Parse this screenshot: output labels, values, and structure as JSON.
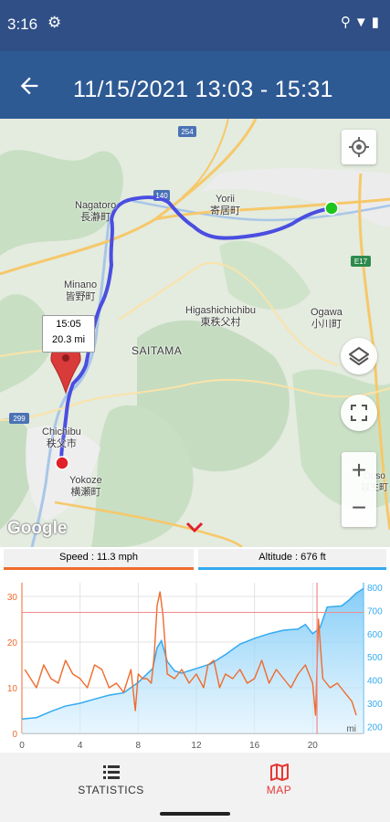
{
  "status": {
    "time": "3:16",
    "icons": [
      "gear-icon",
      "location-icon",
      "wifi-icon",
      "battery-icon"
    ]
  },
  "app_bar": {
    "title": "11/15/2021 13:03 - 15:31",
    "back_icon": "arrow-back-icon"
  },
  "map": {
    "labels": {
      "nagatoro": "Nagatoro\n長瀞町",
      "yorii": "Yorii\n寄居町",
      "minano": "Minano\n皆野町",
      "higashi": "Higashichichibu\n東秩父村",
      "ogawa": "Ogawa\n小川町",
      "saitama": "SAITAMA",
      "chichibu": "Chichibu\n秩父市",
      "yokoze": "Yokoze\n横瀬町",
      "ooso": "Ooso\n越生町",
      "road254": "254",
      "road140": "140",
      "roadE17": "E17",
      "road299": "299"
    },
    "tooltip": {
      "time": "15:05",
      "distance": "20.3 mi"
    },
    "google_logo": "Google",
    "buttons": {
      "my_location": "my-location-icon",
      "layers": "layers-icon",
      "fullscreen": "fullscreen-icon",
      "zoom_in": "+",
      "zoom_out": "−"
    },
    "colors": {
      "route": "#4a4ee0",
      "start": "#1ec51e",
      "end": "#e0202a",
      "marker": "#d93a3a"
    }
  },
  "chart_tabs": {
    "speed": "Speed : 11.3 mph",
    "altitude": "Altitude : 676 ft"
  },
  "chart_data": {
    "type": "line",
    "x_ticks": [
      "0",
      "4",
      "8",
      "12",
      "16",
      "20"
    ],
    "x_unit": "mi",
    "xlim": [
      0,
      23.5
    ],
    "y_left_ticks": [
      "0",
      "10",
      "20",
      "30"
    ],
    "ylim_left": [
      0,
      33
    ],
    "y_right_ticks": [
      "200",
      "300",
      "400",
      "500",
      "600",
      "700",
      "800"
    ],
    "ylim_right": [
      170,
      820
    ],
    "cursor_x": 20.3,
    "avg_speed": 26.5,
    "series": [
      {
        "axis": "left",
        "color": "#ef6b2d",
        "x": [
          0.2,
          1.0,
          1.5,
          2.0,
          2.5,
          3.0,
          3.5,
          4.0,
          4.5,
          5.0,
          5.5,
          6.0,
          6.5,
          7.0,
          7.5,
          7.8,
          8.0,
          8.3,
          8.6,
          8.9,
          9.1,
          9.3,
          9.5,
          9.7,
          10.0,
          10.5,
          11.0,
          11.5,
          12.0,
          12.5,
          12.8,
          13.2,
          13.6,
          14.0,
          14.5,
          15.0,
          15.5,
          16.0,
          16.5,
          17.0,
          17.5,
          18.0,
          18.5,
          19.0,
          19.5,
          20.0,
          20.2,
          20.4,
          20.7,
          21.2,
          21.7,
          22.2,
          22.7,
          23.0
        ],
        "values": [
          14,
          10,
          15,
          12,
          11,
          16,
          13,
          12,
          10,
          15,
          14,
          10,
          11,
          9,
          14,
          5,
          13,
          12,
          12,
          11,
          17,
          28,
          31,
          26,
          13,
          12,
          14,
          11,
          13,
          10,
          15,
          16,
          10,
          13,
          12,
          14,
          11,
          12,
          16,
          11,
          14,
          12,
          10,
          13,
          15,
          11,
          4,
          25,
          12,
          10,
          11,
          9,
          7,
          4
        ]
      },
      {
        "axis": "right",
        "color": "#33aaf0",
        "x": [
          0,
          1,
          2,
          3,
          4,
          5,
          6,
          7,
          8,
          8.5,
          9,
          9.3,
          9.6,
          10,
          10.5,
          11,
          12,
          13,
          14,
          15,
          16,
          17,
          18,
          19,
          19.5,
          20,
          20.5,
          21,
          22,
          22.5,
          23,
          23.5
        ],
        "values": [
          232,
          238,
          265,
          288,
          300,
          318,
          335,
          345,
          390,
          420,
          450,
          540,
          570,
          480,
          440,
          430,
          450,
          470,
          510,
          555,
          580,
          600,
          615,
          620,
          640,
          600,
          625,
          715,
          720,
          745,
          775,
          795
        ]
      }
    ]
  },
  "bottom_nav": {
    "statistics": {
      "label": "STATISTICS",
      "icon": "list-icon"
    },
    "map": {
      "label": "MAP",
      "icon": "map-icon"
    }
  }
}
